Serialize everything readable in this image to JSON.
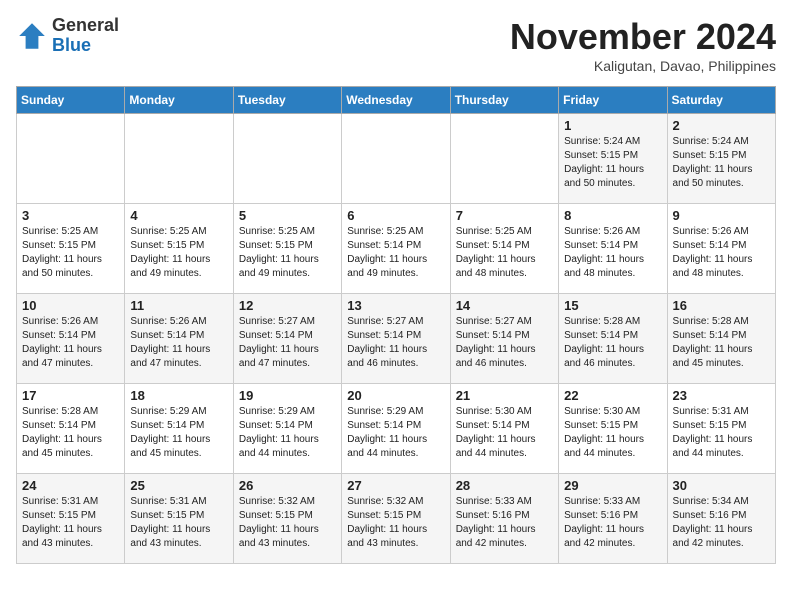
{
  "logo": {
    "general": "General",
    "blue": "Blue"
  },
  "title": "November 2024",
  "location": "Kaligutan, Davao, Philippines",
  "days_of_week": [
    "Sunday",
    "Monday",
    "Tuesday",
    "Wednesday",
    "Thursday",
    "Friday",
    "Saturday"
  ],
  "weeks": [
    [
      {
        "day": "",
        "sunrise": "",
        "sunset": "",
        "daylight": ""
      },
      {
        "day": "",
        "sunrise": "",
        "sunset": "",
        "daylight": ""
      },
      {
        "day": "",
        "sunrise": "",
        "sunset": "",
        "daylight": ""
      },
      {
        "day": "",
        "sunrise": "",
        "sunset": "",
        "daylight": ""
      },
      {
        "day": "",
        "sunrise": "",
        "sunset": "",
        "daylight": ""
      },
      {
        "day": "1",
        "sunrise": "Sunrise: 5:24 AM",
        "sunset": "Sunset: 5:15 PM",
        "daylight": "Daylight: 11 hours and 50 minutes."
      },
      {
        "day": "2",
        "sunrise": "Sunrise: 5:24 AM",
        "sunset": "Sunset: 5:15 PM",
        "daylight": "Daylight: 11 hours and 50 minutes."
      }
    ],
    [
      {
        "day": "3",
        "sunrise": "Sunrise: 5:25 AM",
        "sunset": "Sunset: 5:15 PM",
        "daylight": "Daylight: 11 hours and 50 minutes."
      },
      {
        "day": "4",
        "sunrise": "Sunrise: 5:25 AM",
        "sunset": "Sunset: 5:15 PM",
        "daylight": "Daylight: 11 hours and 49 minutes."
      },
      {
        "day": "5",
        "sunrise": "Sunrise: 5:25 AM",
        "sunset": "Sunset: 5:15 PM",
        "daylight": "Daylight: 11 hours and 49 minutes."
      },
      {
        "day": "6",
        "sunrise": "Sunrise: 5:25 AM",
        "sunset": "Sunset: 5:14 PM",
        "daylight": "Daylight: 11 hours and 49 minutes."
      },
      {
        "day": "7",
        "sunrise": "Sunrise: 5:25 AM",
        "sunset": "Sunset: 5:14 PM",
        "daylight": "Daylight: 11 hours and 48 minutes."
      },
      {
        "day": "8",
        "sunrise": "Sunrise: 5:26 AM",
        "sunset": "Sunset: 5:14 PM",
        "daylight": "Daylight: 11 hours and 48 minutes."
      },
      {
        "day": "9",
        "sunrise": "Sunrise: 5:26 AM",
        "sunset": "Sunset: 5:14 PM",
        "daylight": "Daylight: 11 hours and 48 minutes."
      }
    ],
    [
      {
        "day": "10",
        "sunrise": "Sunrise: 5:26 AM",
        "sunset": "Sunset: 5:14 PM",
        "daylight": "Daylight: 11 hours and 47 minutes."
      },
      {
        "day": "11",
        "sunrise": "Sunrise: 5:26 AM",
        "sunset": "Sunset: 5:14 PM",
        "daylight": "Daylight: 11 hours and 47 minutes."
      },
      {
        "day": "12",
        "sunrise": "Sunrise: 5:27 AM",
        "sunset": "Sunset: 5:14 PM",
        "daylight": "Daylight: 11 hours and 47 minutes."
      },
      {
        "day": "13",
        "sunrise": "Sunrise: 5:27 AM",
        "sunset": "Sunset: 5:14 PM",
        "daylight": "Daylight: 11 hours and 46 minutes."
      },
      {
        "day": "14",
        "sunrise": "Sunrise: 5:27 AM",
        "sunset": "Sunset: 5:14 PM",
        "daylight": "Daylight: 11 hours and 46 minutes."
      },
      {
        "day": "15",
        "sunrise": "Sunrise: 5:28 AM",
        "sunset": "Sunset: 5:14 PM",
        "daylight": "Daylight: 11 hours and 46 minutes."
      },
      {
        "day": "16",
        "sunrise": "Sunrise: 5:28 AM",
        "sunset": "Sunset: 5:14 PM",
        "daylight": "Daylight: 11 hours and 45 minutes."
      }
    ],
    [
      {
        "day": "17",
        "sunrise": "Sunrise: 5:28 AM",
        "sunset": "Sunset: 5:14 PM",
        "daylight": "Daylight: 11 hours and 45 minutes."
      },
      {
        "day": "18",
        "sunrise": "Sunrise: 5:29 AM",
        "sunset": "Sunset: 5:14 PM",
        "daylight": "Daylight: 11 hours and 45 minutes."
      },
      {
        "day": "19",
        "sunrise": "Sunrise: 5:29 AM",
        "sunset": "Sunset: 5:14 PM",
        "daylight": "Daylight: 11 hours and 44 minutes."
      },
      {
        "day": "20",
        "sunrise": "Sunrise: 5:29 AM",
        "sunset": "Sunset: 5:14 PM",
        "daylight": "Daylight: 11 hours and 44 minutes."
      },
      {
        "day": "21",
        "sunrise": "Sunrise: 5:30 AM",
        "sunset": "Sunset: 5:14 PM",
        "daylight": "Daylight: 11 hours and 44 minutes."
      },
      {
        "day": "22",
        "sunrise": "Sunrise: 5:30 AM",
        "sunset": "Sunset: 5:15 PM",
        "daylight": "Daylight: 11 hours and 44 minutes."
      },
      {
        "day": "23",
        "sunrise": "Sunrise: 5:31 AM",
        "sunset": "Sunset: 5:15 PM",
        "daylight": "Daylight: 11 hours and 44 minutes."
      }
    ],
    [
      {
        "day": "24",
        "sunrise": "Sunrise: 5:31 AM",
        "sunset": "Sunset: 5:15 PM",
        "daylight": "Daylight: 11 hours and 43 minutes."
      },
      {
        "day": "25",
        "sunrise": "Sunrise: 5:31 AM",
        "sunset": "Sunset: 5:15 PM",
        "daylight": "Daylight: 11 hours and 43 minutes."
      },
      {
        "day": "26",
        "sunrise": "Sunrise: 5:32 AM",
        "sunset": "Sunset: 5:15 PM",
        "daylight": "Daylight: 11 hours and 43 minutes."
      },
      {
        "day": "27",
        "sunrise": "Sunrise: 5:32 AM",
        "sunset": "Sunset: 5:15 PM",
        "daylight": "Daylight: 11 hours and 43 minutes."
      },
      {
        "day": "28",
        "sunrise": "Sunrise: 5:33 AM",
        "sunset": "Sunset: 5:16 PM",
        "daylight": "Daylight: 11 hours and 42 minutes."
      },
      {
        "day": "29",
        "sunrise": "Sunrise: 5:33 AM",
        "sunset": "Sunset: 5:16 PM",
        "daylight": "Daylight: 11 hours and 42 minutes."
      },
      {
        "day": "30",
        "sunrise": "Sunrise: 5:34 AM",
        "sunset": "Sunset: 5:16 PM",
        "daylight": "Daylight: 11 hours and 42 minutes."
      }
    ]
  ]
}
